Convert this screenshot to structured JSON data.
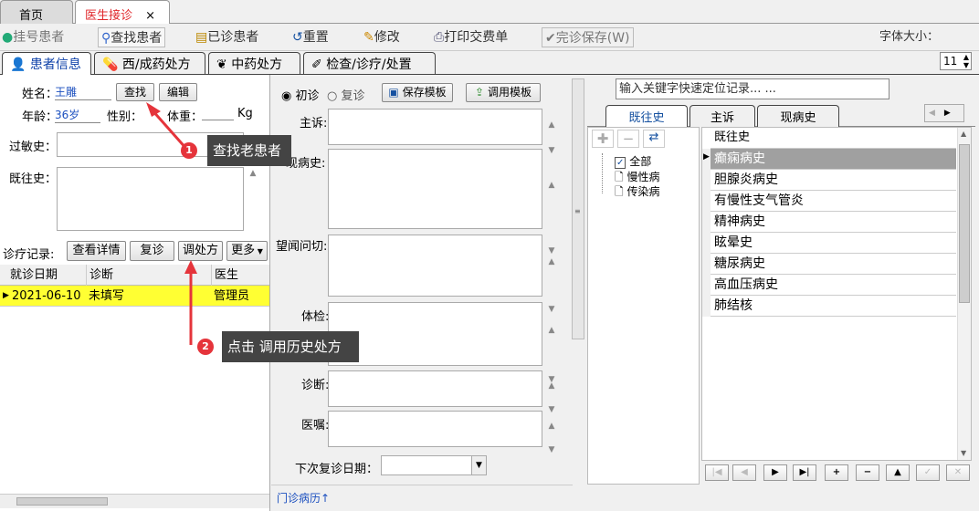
{
  "tabs": {
    "home": "首页",
    "doctor": "医生接诊",
    "close": "×"
  },
  "toolbar": {
    "register": "挂号患者",
    "find": "查找患者",
    "seen": "已诊患者",
    "reset": "重置",
    "edit": "修改",
    "print": "打印交费单",
    "finish": "完诊保存(W)",
    "font_label": "字体大小：",
    "font_value": "11"
  },
  "subtabs": [
    "患者信息",
    "西/成药处方",
    "中药处方",
    "检查/诊疗/处置"
  ],
  "patient": {
    "name_label": "姓名：",
    "name": "王雕",
    "find_btn": "查找",
    "edit_btn": "编辑",
    "age_label": "年龄：",
    "age": "36岁",
    "gender_label": "性别：",
    "weight_label": "体重：",
    "weight_unit": "Kg",
    "allergy_label": "过敏史：",
    "history_label": "既往史："
  },
  "records": {
    "label": "诊疗记录:",
    "detail": "查看详情",
    "revisit": "复诊",
    "adjust": "调处方",
    "more": "更多",
    "headers": [
      "就诊日期",
      "诊断",
      "医生"
    ],
    "rows": [
      {
        "date": "2021-06-10",
        "diagnosis": "未填写",
        "doctor": "管理员"
      }
    ]
  },
  "visit": {
    "first": "初诊",
    "revisit": "复诊",
    "save_tpl": "保存模板",
    "use_tpl": "调用模板",
    "complaint": "主诉:",
    "present": "现病史:",
    "inspect": "望闻问切:",
    "exam": "体检:",
    "diagnosis": "诊断:",
    "advice": "医嘱:",
    "next_date": "下次复诊日期：",
    "footer_link": "门诊病历↑"
  },
  "right": {
    "search_placeholder": "输入关键字快速定位记录... ...",
    "tabs": [
      "既往史",
      "主诉",
      "现病史"
    ],
    "tree": [
      "全部",
      "慢性病",
      "传染病"
    ],
    "list_header": "既往史",
    "items": [
      "癫痫病史",
      "胆腺炎病史",
      "有慢性支气管炎",
      "精神病史",
      "眩晕史",
      "糖尿病史",
      "高血压病史",
      "肺结核"
    ]
  },
  "annotations": [
    {
      "num": "1",
      "text": "查找老患者"
    },
    {
      "num": "2",
      "text": "点击 调用历史处方"
    }
  ],
  "colors": {
    "active_tab": "#e0282c",
    "highlight_row": "#ffff33",
    "selected_item": "#a0a0a0",
    "annotation_bg": "#444444",
    "marker": "#e5343b"
  }
}
